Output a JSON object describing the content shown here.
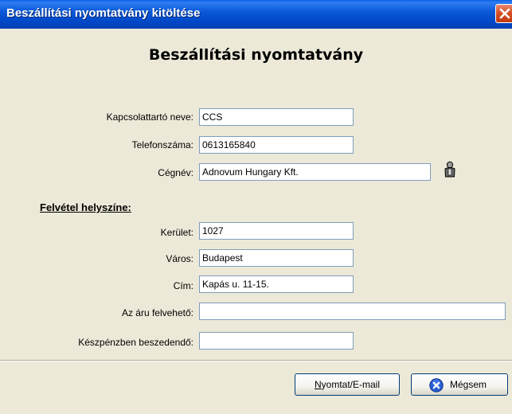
{
  "window": {
    "title": "Beszállítási nyomtatvány kitöltése"
  },
  "heading": "Beszállítási nyomtatvány",
  "fields": {
    "contact_name": {
      "label": "Kapcsolattartó neve:",
      "value": "CCS"
    },
    "phone": {
      "label": "Telefonszáma:",
      "value": "0613165840"
    },
    "company": {
      "label": "Cégnév:",
      "value": "Adnovum Hungary Kft."
    },
    "district": {
      "label": "Kerület:",
      "value": "1027"
    },
    "city": {
      "label": "Város:",
      "value": "Budapest"
    },
    "address": {
      "label": "Cím:",
      "value": "Kapás u. 11-15."
    },
    "pickup": {
      "label": "Az áru felvehető:",
      "value": ""
    },
    "cash": {
      "label": "Készpénzben beszedendő:",
      "value": ""
    }
  },
  "section": {
    "pickup_location": "Felvétel helyszíne:"
  },
  "buttons": {
    "print_mnemonic": "N",
    "print_rest": "yomtat/E-mail",
    "cancel": "Mégsem"
  },
  "icons": {
    "close": "close-icon",
    "contact": "person-icon",
    "cancel": "cancel-x-icon"
  }
}
